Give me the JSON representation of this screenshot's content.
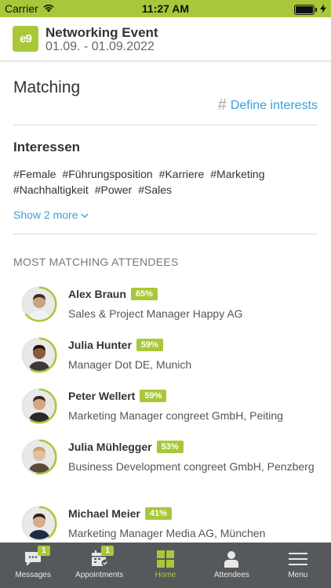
{
  "status_bar": {
    "carrier": "Carrier",
    "time": "11:27 AM"
  },
  "header": {
    "logo_text": "e9",
    "title": "Networking Event",
    "dates": "01.09. - 01.09.2022"
  },
  "matching": {
    "title": "Matching",
    "define_interests": "Define interests",
    "interests_title": "Interessen",
    "tags": [
      "#Female",
      "#Führungsposition",
      "#Karriere",
      "#Marketing",
      "#Nachhaltigkeit",
      "#Power",
      "#Sales"
    ],
    "show_more": "Show 2 more"
  },
  "attendees_heading": "MOST MATCHING ATTENDEES",
  "attendees": [
    {
      "name": "Alex Braun",
      "match": "65%",
      "match_value": 0.65,
      "job": "Sales & Project Manager Happy AG",
      "avatar_color": "#c9a27f",
      "hair": "#3b2a1e",
      "shirt": "#f2f2f2"
    },
    {
      "name": "Julia Hunter",
      "match": "59%",
      "match_value": 0.59,
      "job": "Manager Dot DE, Munich",
      "avatar_color": "#8a5a3c",
      "hair": "#1e130c",
      "shirt": "#3a3a3a"
    },
    {
      "name": "Peter Wellert",
      "match": "59%",
      "match_value": 0.59,
      "job": "Marketing Manager congreet GmbH, Peiting",
      "avatar_color": "#d2a784",
      "hair": "#3c2a1a",
      "shirt": "#2a2a2a"
    },
    {
      "name": "Julia Mühlegger",
      "match": "53%",
      "match_value": 0.53,
      "job": "Business Development congreet GmbH, Penzberg",
      "avatar_color": "#e2bfa0",
      "hair": "#c9a062",
      "shirt": "#5a4a3a"
    },
    {
      "name": "Michael Meier",
      "match": "41%",
      "match_value": 0.41,
      "job": "Marketing Manager Media AG, München",
      "avatar_color": "#d6ad8e",
      "hair": "#2d1f15",
      "shirt": "#1f2a44"
    }
  ],
  "tabbar": {
    "items": [
      {
        "label": "Messages",
        "icon": "chat-icon",
        "badge": "1"
      },
      {
        "label": "Appointments",
        "icon": "calendar-check-icon",
        "badge": "1"
      },
      {
        "label": "Home",
        "icon": "home-grid-icon",
        "badge": ""
      },
      {
        "label": "Attendees",
        "icon": "person-icon",
        "badge": ""
      },
      {
        "label": "Menu",
        "icon": "hamburger-menu-icon",
        "badge": ""
      }
    ]
  },
  "colors": {
    "accent": "#a8c83a",
    "link": "#3aa0d8",
    "tabbar": "#55595c"
  }
}
